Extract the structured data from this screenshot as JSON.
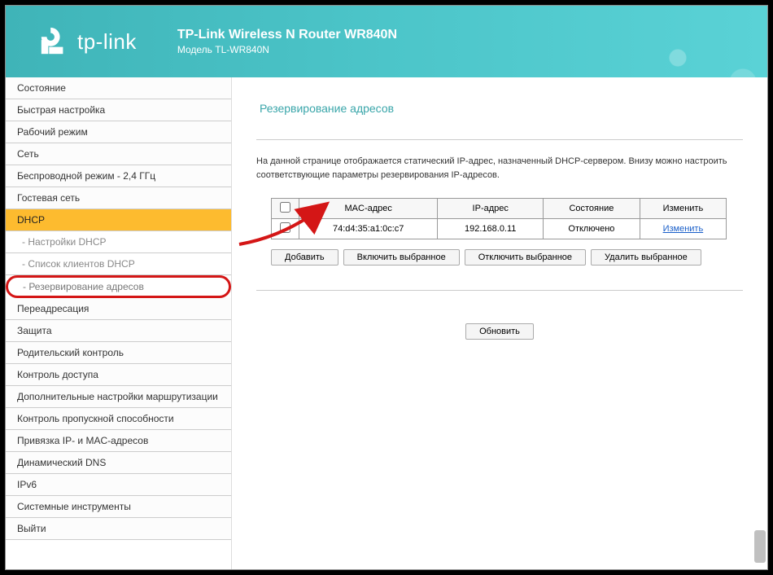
{
  "header": {
    "brand": "tp-link",
    "title": "TP-Link Wireless N Router WR840N",
    "subtitle": "Модель TL-WR840N"
  },
  "menu": [
    {
      "label": "Состояние",
      "type": "item"
    },
    {
      "label": "Быстрая настройка",
      "type": "item"
    },
    {
      "label": "Рабочий режим",
      "type": "item"
    },
    {
      "label": "Сеть",
      "type": "item"
    },
    {
      "label": "Беспроводной режим - 2,4 ГГц",
      "type": "item"
    },
    {
      "label": "Гостевая сеть",
      "type": "item"
    },
    {
      "label": "DHCP",
      "type": "item",
      "selected": true
    },
    {
      "label": "- Настройки DHCP",
      "type": "sub"
    },
    {
      "label": "- Список клиентов DHCP",
      "type": "sub"
    },
    {
      "label": "- Резервирование адресов",
      "type": "sub",
      "highlighted": true
    },
    {
      "label": "Переадресация",
      "type": "item"
    },
    {
      "label": "Защита",
      "type": "item"
    },
    {
      "label": "Родительский контроль",
      "type": "item"
    },
    {
      "label": "Контроль доступа",
      "type": "item"
    },
    {
      "label": "Дополнительные настройки маршрутизации",
      "type": "item"
    },
    {
      "label": "Контроль пропускной способности",
      "type": "item"
    },
    {
      "label": "Привязка IP- и MAC-адресов",
      "type": "item"
    },
    {
      "label": "Динамический DNS",
      "type": "item"
    },
    {
      "label": "IPv6",
      "type": "item"
    },
    {
      "label": "Системные инструменты",
      "type": "item"
    },
    {
      "label": "Выйти",
      "type": "item"
    }
  ],
  "page": {
    "heading": "Резервирование адресов",
    "description": "На данной странице отображается статический IP-адрес, назначенный DHCP-сервером. Внизу можно настроить соответствующие параметры резервирования IP-адресов.",
    "table": {
      "headers": {
        "mac": "MAC-адрес",
        "ip": "IP-адрес",
        "state": "Состояние",
        "edit": "Изменить"
      },
      "rows": [
        {
          "mac": "74:d4:35:a1:0c:c7",
          "ip": "192.168.0.11",
          "state": "Отключено",
          "edit": "Изменить"
        }
      ]
    },
    "buttons": {
      "add": "Добавить",
      "enable_sel": "Включить выбранное",
      "disable_sel": "Отключить выбранное",
      "delete_sel": "Удалить выбранное",
      "refresh": "Обновить"
    }
  }
}
